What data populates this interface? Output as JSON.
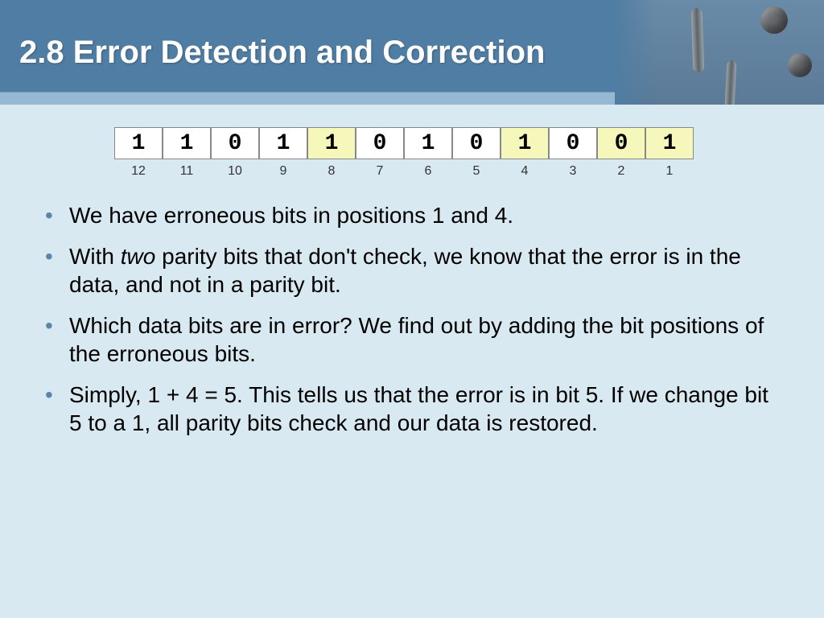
{
  "header": {
    "title": "2.8 Error Detection and Correction"
  },
  "bit_table": {
    "bits": [
      "1",
      "1",
      "0",
      "1",
      "1",
      "0",
      "1",
      "0",
      "1",
      "0",
      "0",
      "1"
    ],
    "positions": [
      "12",
      "11",
      "10",
      "9",
      "8",
      "7",
      "6",
      "5",
      "4",
      "3",
      "2",
      "1"
    ],
    "highlighted_positions": [
      "8",
      "4",
      "2",
      "1"
    ]
  },
  "bullets": [
    {
      "text": "We have erroneous bits in positions 1 and 4."
    },
    {
      "pre": "With ",
      "em": "two",
      "post": " parity bits that don't check, we know that the error is in the data, and not in a parity bit."
    },
    {
      "text": "Which data bits are in error?  We find out by adding the bit positions of the erroneous bits."
    },
    {
      "text": "Simply, 1 + 4 = 5.  This tells us that the error is in bit 5. If we change bit 5 to a 1, all parity bits check and our data is restored."
    }
  ]
}
